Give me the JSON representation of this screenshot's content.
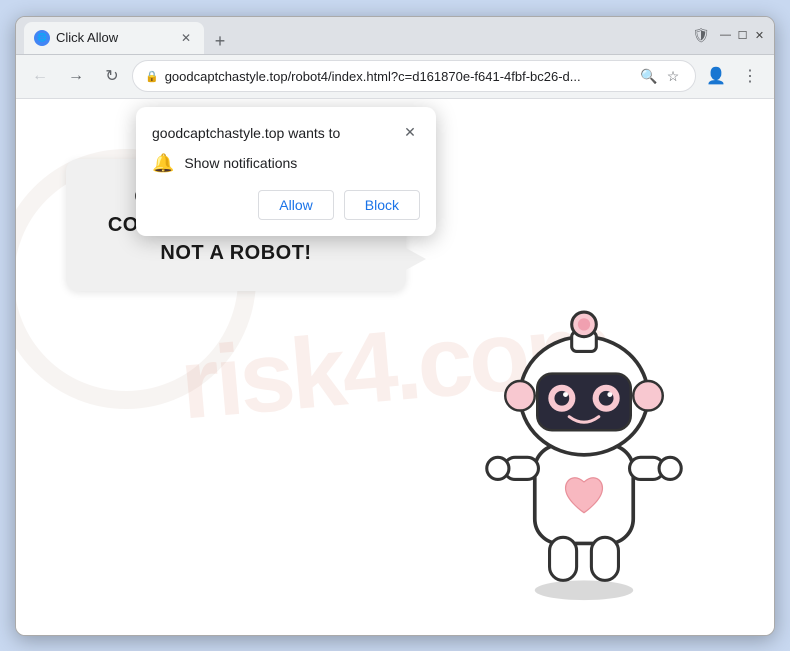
{
  "browser": {
    "tab": {
      "title": "Click Allow",
      "favicon_symbol": "🌐"
    },
    "new_tab_symbol": "+",
    "window_controls": {
      "minimize": "—",
      "maximize": "☐",
      "close": "✕"
    },
    "nav": {
      "back_symbol": "←",
      "forward_symbol": "→",
      "reload_symbol": "↻",
      "address": "goodcaptchastyle.top/robot4/index.html?c=d161870e-f641-4fbf-bc26-d...",
      "lock_symbol": "🔒"
    },
    "toolbar_icons": {
      "search_symbol": "🔍",
      "bookmark_symbol": "☆",
      "profile_symbol": "👤",
      "menu_symbol": "⋮",
      "shield_symbol": "🛡"
    }
  },
  "notification_popup": {
    "site_text": "goodcaptchastyle.top wants to",
    "close_symbol": "✕",
    "permission_label": "Show notifications",
    "bell_symbol": "🔔",
    "allow_label": "Allow",
    "block_label": "Block"
  },
  "page": {
    "speech_bubble_text": "CLICK «ALLOW» TO CONFIRM THAT YOU ARE NOT A ROBOT!",
    "watermark_text": "risk4.com"
  },
  "colors": {
    "accent_blue": "#1a73e8",
    "text_dark": "#202124",
    "border_gray": "#dadce0",
    "background": "#f1f3f4"
  }
}
